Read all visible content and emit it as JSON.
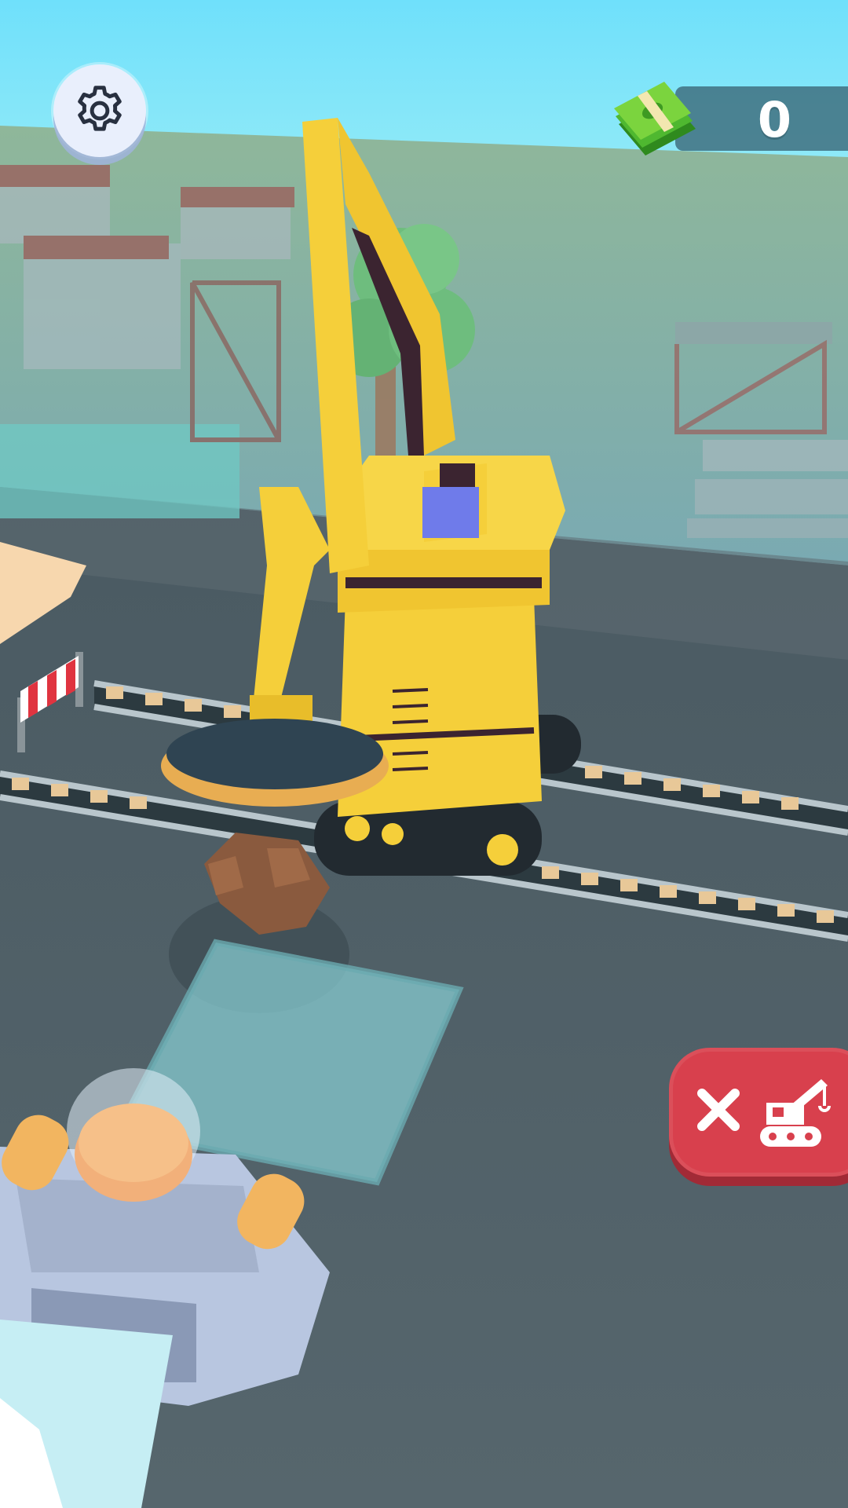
{
  "hud": {
    "settings_icon": "gear-icon",
    "currency_icon": "cash-stack-icon",
    "currency_amount": "0",
    "action_button": {
      "icons": [
        "close-icon",
        "crane-icon"
      ],
      "color": "#d8404d"
    }
  },
  "colors": {
    "sky": "#6fe0fb",
    "road": "#4f5f66",
    "crane_yellow": "#f5cf3a",
    "hud_panel": "#407080"
  }
}
